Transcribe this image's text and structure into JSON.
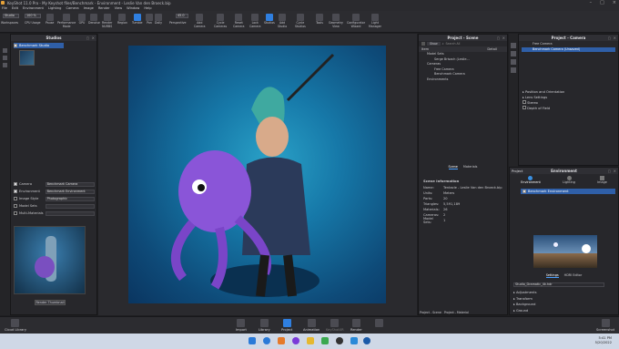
{
  "window": {
    "title": "KeyShot 11.0 Pro - My Keyshot files/Benchmark - Environment - Leslie Van den Broeck.bip",
    "controls": [
      "–",
      "□",
      "×"
    ]
  },
  "menu": [
    "File",
    "Edit",
    "Environment",
    "Lighting",
    "Camera",
    "Image",
    "Render",
    "View",
    "Window",
    "Help"
  ],
  "toolbar": {
    "workspace_value": "Studio",
    "cpu_value": "100 %",
    "fov_value": "45.0",
    "left": [
      {
        "label": "Workspaces"
      },
      {
        "label": "CPU Usage"
      },
      {
        "label": "Pause"
      },
      {
        "label": "Performance\nMode"
      },
      {
        "label": "GPU"
      },
      {
        "label": "Denoise"
      },
      {
        "label": "Render\nNURBS"
      },
      {
        "label": "Region"
      },
      {
        "label": "Tumble"
      },
      {
        "label": "Pan"
      },
      {
        "label": "Dolly"
      },
      {
        "label": "Perspective"
      }
    ],
    "right": [
      {
        "label": "Add\nCamera"
      },
      {
        "label": "Cycle\nCameras"
      },
      {
        "label": "Reset\nCamera"
      },
      {
        "label": "Lock\nCamera"
      },
      {
        "label": "Studios"
      },
      {
        "label": "Add\nStudio"
      },
      {
        "label": "Cycle\nStudios"
      },
      {
        "label": "Tools"
      },
      {
        "label": "Geometry\nView"
      },
      {
        "label": "Configurator\nWizard"
      },
      {
        "label": "Light\nManager"
      }
    ]
  },
  "studios": {
    "title": "Studios",
    "item": "Benchmark Studio",
    "props": [
      {
        "label": "Camera",
        "value": "Benchmark Camera",
        "checked": true
      },
      {
        "label": "Environment",
        "value": "Benchmark Environment",
        "checked": true
      },
      {
        "label": "Image Style",
        "value": "Photographic",
        "checked": false
      },
      {
        "label": "Model Sets",
        "value": "",
        "checked": false
      },
      {
        "label": "Multi-Materials",
        "value": "",
        "checked": false
      }
    ],
    "render_btn": "Render Thumbnail"
  },
  "scene": {
    "title": "Project - Scene",
    "show_btn": "Show",
    "search_placeholder": "Search All",
    "col_item": "Item",
    "col_detail": "Detail",
    "tree": [
      "Model Sets",
      "Serge Brisach (Leslie...",
      "Cameras",
      "Free Camera",
      "Benchmark Camera",
      "Environments"
    ],
    "tabs": [
      "Scene",
      "Materials"
    ],
    "info_title": "Scene Information",
    "info": [
      {
        "k": "Name:",
        "v": "Tentacle - Leslie Van den Broeck.bip"
      },
      {
        "k": "Units:",
        "v": "Meters"
      },
      {
        "k": "Parts:",
        "v": "20"
      },
      {
        "k": "Triangles:",
        "v": "5,591,189"
      },
      {
        "k": "Materials:",
        "v": "26"
      },
      {
        "k": "Cameras:",
        "v": "2"
      },
      {
        "k": "Model Sets:",
        "v": "1"
      }
    ],
    "bottom_tabs": [
      "Project - Scene",
      "Project - Material"
    ]
  },
  "camera": {
    "title": "Project - Camera",
    "items": [
      "Free Camera",
      "Benchmark Camera (Unsaved)"
    ],
    "sections": [
      "Position and Orientation",
      "Lens Settings",
      "Stereo",
      "Depth of Field"
    ]
  },
  "environment": {
    "project_label": "Project",
    "title": "Environment",
    "tabs": [
      "Environment",
      "Lighting",
      "Image"
    ],
    "item": "Benchmark Environment",
    "sub_tabs": [
      "Settings",
      "HDRI Editor"
    ],
    "file": "Studio_Dramatic_4k.hdr",
    "sections": [
      "Adjustments",
      "Transform",
      "Background",
      "Ground"
    ]
  },
  "bottombar": {
    "left": "Cloud Library",
    "center": [
      "Import",
      "Library",
      "Project",
      "Animation",
      "KeyShotXR",
      "Render"
    ],
    "right": "Screenshot"
  },
  "taskbar": {
    "time": "5:41 PM",
    "date": "5/20/2022"
  }
}
